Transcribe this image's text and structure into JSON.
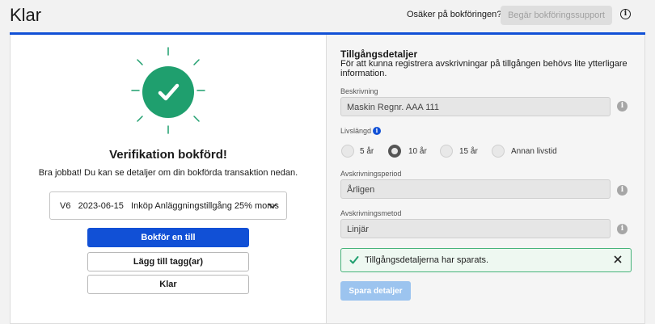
{
  "header": {
    "title": "Klar",
    "unsure_text": "Osäker på bokföringen?",
    "support_button": "Begär bokföringssupport",
    "info_icon": "info-icon"
  },
  "left": {
    "success_title": "Verifikation bokförd!",
    "success_subtitle": "Bra jobbat! Du kan se detaljer om din bokförda transaktion nedan.",
    "transaction": "V6   2023-06-15   Inköp Anläggningstillgång 25% moms",
    "buttons": {
      "book_another": "Bokför en till",
      "add_tag": "Lägg till tagg(ar)",
      "done": "Klar"
    }
  },
  "right": {
    "title": "Tillgångsdetaljer",
    "description": "För att kunna registrera avskrivningar på tillgången behövs lite ytterligare information.",
    "description_field": {
      "label": "Beskrivning",
      "value": "Maskin Regnr. AAA 111"
    },
    "lifetime": {
      "label": "Livslängd",
      "options": [
        "5 år",
        "10 år",
        "15 år",
        "Annan livstid"
      ],
      "selected": "10 år"
    },
    "period_field": {
      "label": "Avskrivningsperiod",
      "value": "Årligen"
    },
    "method_field": {
      "label": "Avskrivningsmetod",
      "value": "Linjär"
    },
    "alert_text": "Tillgångsdetaljerna har sparats.",
    "save_button": "Spara detaljer"
  },
  "colors": {
    "accent": "#1150d6",
    "success_green": "#1f9f6e",
    "save_disabled": "#9cc4ef"
  }
}
